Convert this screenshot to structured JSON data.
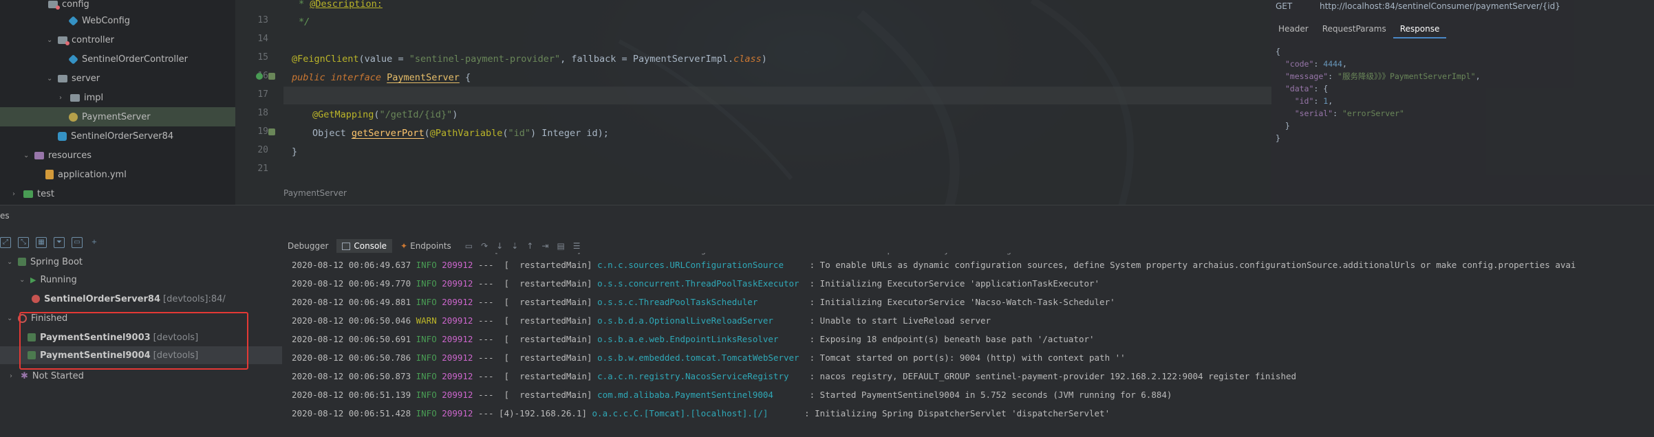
{
  "project_tree": {
    "items": [
      {
        "label": "config"
      },
      {
        "label": "WebConfig"
      },
      {
        "label": "controller"
      },
      {
        "label": "SentinelOrderController"
      },
      {
        "label": "server"
      },
      {
        "label": "impl"
      },
      {
        "label": "PaymentServer"
      },
      {
        "label": "SentinelOrderServer84"
      },
      {
        "label": "resources"
      },
      {
        "label": "application.yml"
      },
      {
        "label": "test"
      }
    ]
  },
  "editor": {
    "line_numbers": [
      "13",
      "14",
      "15",
      "16",
      "17",
      "18",
      "19",
      "20",
      "21"
    ],
    "lines": {
      "l12_annot": "@Description:",
      "l13_comment": "*/",
      "l15_ann": "@FeignClient",
      "l15_p1": "(value = ",
      "l15_s1": "\"sentinel-payment-provider\"",
      "l15_p2": ", fallback = PaymentServerImpl.",
      "l15_kw": "class",
      "l15_p3": ")",
      "l16_kw": "public interface ",
      "l16_name": "PaymentServer",
      "l16_p": " {",
      "l18_ann": "@GetMapping",
      "l18_p1": "(",
      "l18_s": "\"/getId/{id}\"",
      "l18_p2": ")",
      "l19_p1": "Object ",
      "l19_m": "getServerPort",
      "l19_p2": "(",
      "l19_ann": "@PathVariable",
      "l19_p3": "(",
      "l19_s": "\"id\"",
      "l19_p4": ") Integer id);",
      "l20": "}"
    },
    "breadcrumb": "PaymentServer"
  },
  "rest_client": {
    "method": "GET",
    "url": "http://localhost:84/sentinelConsumer/paymentServer/{id}",
    "tabs": [
      "Header",
      "RequestParams",
      "Response"
    ],
    "active_tab": "Response",
    "response": {
      "open": "{",
      "code_key": "\"code\"",
      "code_val": "4444",
      "message_key": "\"message\"",
      "message_val": "\"服务降级》》》PaymentServerImpl\"",
      "data_key": "\"data\"",
      "id_key": "\"id\"",
      "id_val": "1",
      "serial_key": "\"serial\"",
      "serial_val": "\"errorServer\"",
      "close_inner": "}",
      "close": "}"
    }
  },
  "services_panel": {
    "title": "es",
    "tree": {
      "spring_boot": "Spring Boot",
      "running": "Running",
      "running_item": {
        "name": "SentinelOrderServer84",
        "tag": "[devtools]",
        "port": ":84/"
      },
      "finished": "Finished",
      "finished_items": [
        {
          "name": "PaymentSentinel9003",
          "tag": "[devtools]"
        },
        {
          "name": "PaymentSentinel9004",
          "tag": "[devtools]"
        }
      ],
      "not_started": "Not Started"
    }
  },
  "console": {
    "tabs": [
      "Debugger",
      "Console",
      "Endpoints"
    ],
    "active_tab": "Console",
    "logs": [
      {
        "ts": "2020-08-12 00:06:49.637",
        "level": "INFO",
        "pid": "209912",
        "thread": "---  [  restartedMain]",
        "logger": "c.n.c.sources.URLConfigurationSource    ",
        "msg": ": To enable URLs as dynamic configuration sources, define System property archaius.configurationSource.additionalUrls or make config.properties avai"
      },
      {
        "ts": "2020-08-12 00:06:49.770",
        "level": "INFO",
        "pid": "209912",
        "thread": "---  [  restartedMain]",
        "logger": "o.s.s.concurrent.ThreadPoolTaskExecutor ",
        "msg": ": Initializing ExecutorService 'applicationTaskExecutor'"
      },
      {
        "ts": "2020-08-12 00:06:49.881",
        "level": "INFO",
        "pid": "209912",
        "thread": "---  [  restartedMain]",
        "logger": "o.s.s.c.ThreadPoolTaskScheduler         ",
        "msg": ": Initializing ExecutorService 'Nacso-Watch-Task-Scheduler'"
      },
      {
        "ts": "2020-08-12 00:06:50.046",
        "level": "WARN",
        "pid": "209912",
        "thread": "---  [  restartedMain]",
        "logger": "o.s.b.d.a.OptionalLiveReloadServer      ",
        "msg": ": Unable to start LiveReload server"
      },
      {
        "ts": "2020-08-12 00:06:50.691",
        "level": "INFO",
        "pid": "209912",
        "thread": "---  [  restartedMain]",
        "logger": "o.s.b.a.e.web.EndpointLinksResolver     ",
        "msg": ": Exposing 18 endpoint(s) beneath base path '/actuator'"
      },
      {
        "ts": "2020-08-12 00:06:50.786",
        "level": "INFO",
        "pid": "209912",
        "thread": "---  [  restartedMain]",
        "logger": "o.s.b.w.embedded.tomcat.TomcatWebServer ",
        "msg": ": Tomcat started on port(s): 9004 (http) with context path ''"
      },
      {
        "ts": "2020-08-12 00:06:50.873",
        "level": "INFO",
        "pid": "209912",
        "thread": "---  [  restartedMain]",
        "logger": "c.a.c.n.registry.NacosServiceRegistry   ",
        "msg": ": nacos registry, DEFAULT_GROUP sentinel-payment-provider 192.168.2.122:9004 register finished"
      },
      {
        "ts": "2020-08-12 00:06:51.139",
        "level": "INFO",
        "pid": "209912",
        "thread": "---  [  restartedMain]",
        "logger": "com.md.alibaba.PaymentSentinel9004      ",
        "msg": ": Started PaymentSentinel9004 in 5.752 seconds (JVM running for 6.884)"
      },
      {
        "ts": "2020-08-12 00:06:51.428",
        "level": "INFO",
        "pid": "209912",
        "thread": "--- [4)-192.168.26.1]",
        "logger": "o.a.c.c.C.[Tomcat].[localhost].[/]      ",
        "msg": ": Initializing Spring DispatcherServlet 'dispatcherServlet'"
      }
    ]
  },
  "colors": {
    "selection": "#3d4a3f",
    "highlight_box": "#e53935",
    "info": "#499c54",
    "warn": "#bbb529"
  }
}
